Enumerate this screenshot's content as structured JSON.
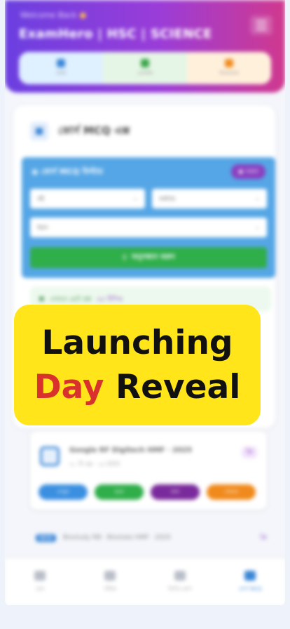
{
  "header": {
    "welcome": "Welcome Back",
    "app_title": "ExamHero | HSC | SCIENCE",
    "quick_tabs": [
      {
        "label": "বাছাই",
        "color": "#3a86d6"
      },
      {
        "label": "প্রোফাইল",
        "color": "#3aa54a"
      },
      {
        "label": "লিডারবোর্ড",
        "color": "#f08a1c"
      }
    ]
  },
  "card": {
    "title": "কোর্স MCQ এক্স",
    "filter": {
      "title": "কোর্স MCQ ফিল্টার",
      "badge": "সকল",
      "select_1": "বই",
      "select_2": "অধ্যায়",
      "select_3": "ধরন",
      "search_label": "অনুসন্ধান করুন"
    },
    "notice": {
      "text": "এখানে মোট প্রশ্ন",
      "count": "৪৫ টিপিক"
    }
  },
  "exam_card": {
    "title": "Google RF Digitech HMF · 2025",
    "subtitle": "৩০ টি প্রশ্ন · ২৫ মিনিট",
    "tag": "ফ্রি",
    "pills": [
      "দেখুন",
      "শুরু",
      "ফল",
      "শেয়ার"
    ]
  },
  "exam_row_2": {
    "badge": "NEW",
    "text": "Biostudy RB · Biostate HMF · 2025",
    "tag": "ফ্রি"
  },
  "bottom_nav": [
    {
      "label": "হোম",
      "icon": "home-icon"
    },
    {
      "label": "পরীক্ষা",
      "icon": "exam-icon"
    },
    {
      "label": "ভিডিও ক্লাস",
      "icon": "video-icon"
    },
    {
      "label": "কোর্স MCQ",
      "icon": "book-icon",
      "active": true
    }
  ],
  "banner": {
    "line1": "Launching",
    "line2_word1": "Day",
    "line2_word2": "Reveal"
  },
  "colors": {
    "header_gradient_start": "#6b3fe0",
    "header_gradient_end": "#d0398e",
    "filter_panel": "#55a6e6",
    "search_button": "#2fae4a",
    "banner_bg": "#ffe51a",
    "banner_accent": "#d9322d"
  }
}
